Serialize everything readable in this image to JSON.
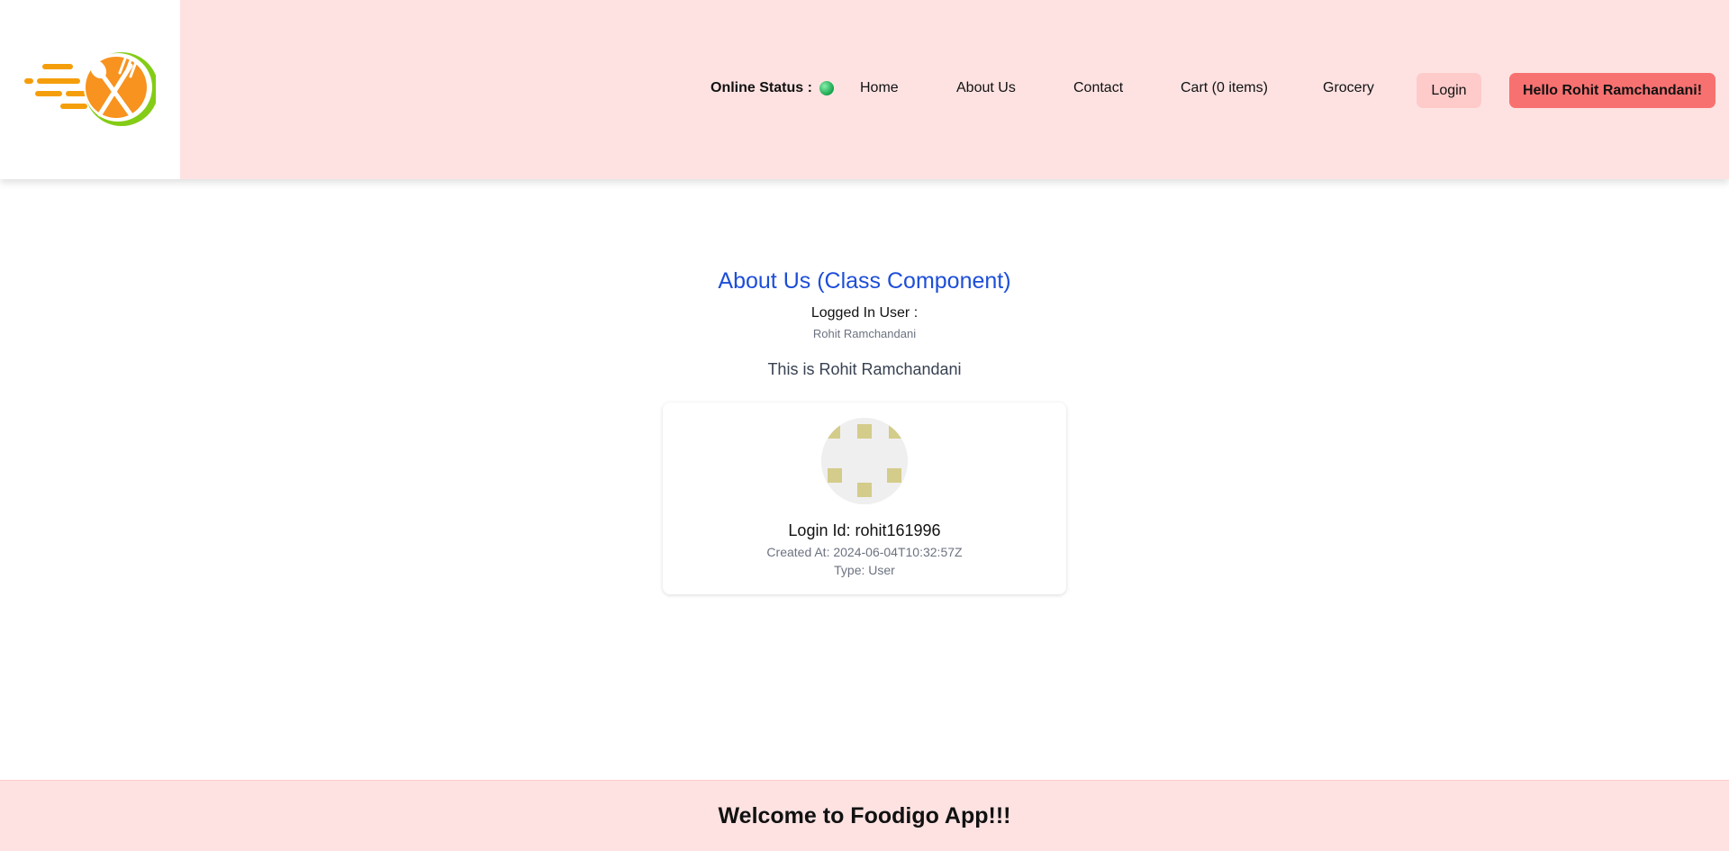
{
  "header": {
    "online_status_label": "Online Status :",
    "online_status_color": "#22c55e",
    "nav": {
      "home": "Home",
      "about": "About Us",
      "contact": "Contact",
      "cart": "Cart (0 items)",
      "grocery": "Grocery",
      "login": "Login",
      "greeting": "Hello Rohit Ramchandani!"
    }
  },
  "about": {
    "title": "About Us (Class Component)",
    "logged_in_label": "Logged In User :",
    "logged_in_name": "Rohit Ramchandani",
    "intro": "This is Rohit Ramchandani"
  },
  "profile_card": {
    "login_id": "Login Id: rohit161996",
    "created_at": "Created At: 2024-06-04T10:32:57Z",
    "type": "Type: User"
  },
  "footer": {
    "text": "Welcome to Foodigo App!!!"
  },
  "colors": {
    "header_bg": "#fee2e2",
    "accent_blue": "#1d4ed8",
    "greeting_bg": "#f87171",
    "login_bg": "#fecaca"
  }
}
